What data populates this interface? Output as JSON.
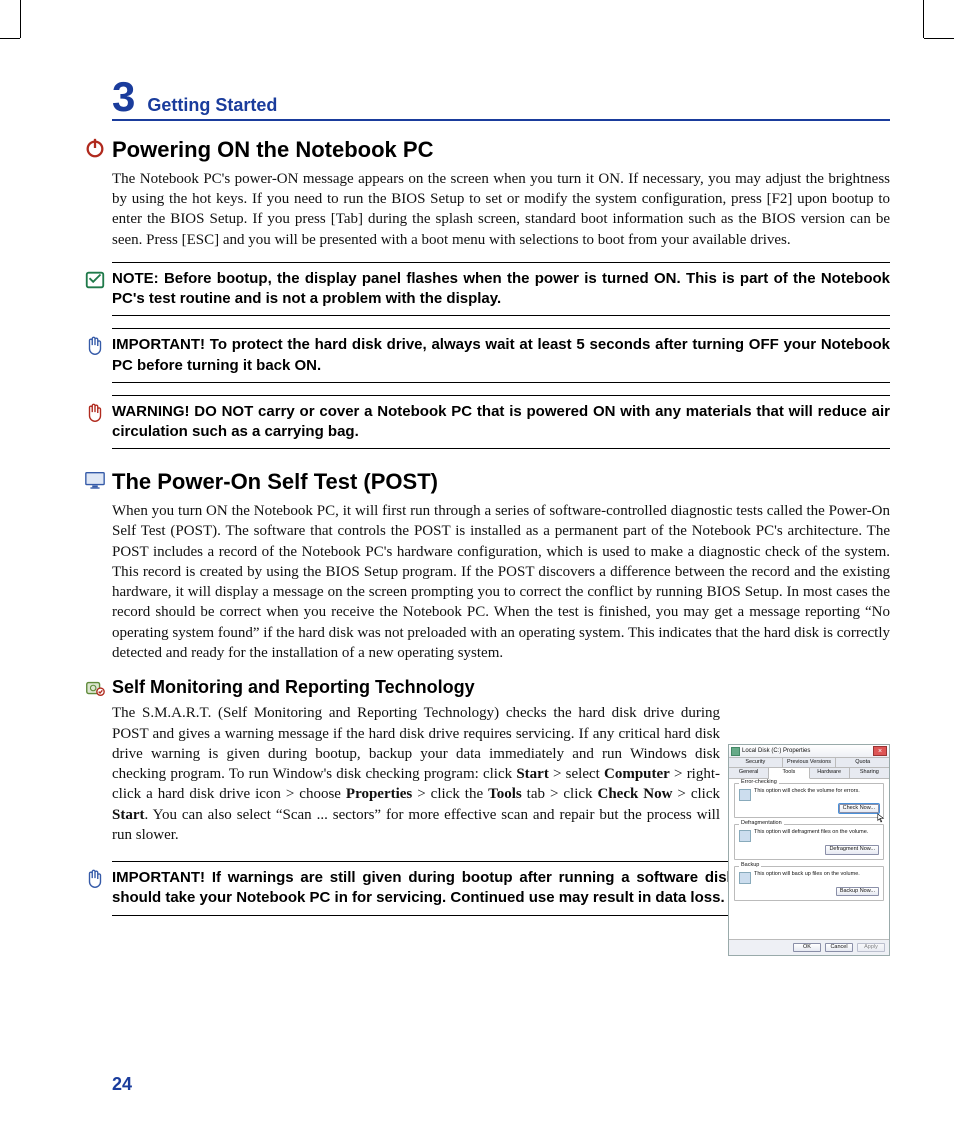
{
  "chapter": {
    "number": "3",
    "title": "Getting Started"
  },
  "page_number": "24",
  "sections": {
    "power_on": {
      "heading": "Powering ON the Notebook PC",
      "body": "The Notebook PC's power-ON message appears on the screen when you turn it ON. If necessary, you may adjust the brightness by using the hot keys. If you need to run the BIOS Setup to set or modify the system configuration, press [F2] upon bootup to enter the BIOS Setup. If you press [Tab] during the splash screen, standard boot information such as the BIOS version can be seen. Press [ESC] and you will be presented with a boot menu with selections to boot from your available drives."
    },
    "post": {
      "heading": "The Power-On Self Test (POST)",
      "body": "When you turn ON the Notebook PC, it will first run through a series of software-controlled diagnostic tests called the Power-On Self Test (POST). The software that controls the POST is installed as a permanent part of the Notebook PC's architecture. The POST includes a record of the Notebook PC's hardware configuration, which is used to make a diagnostic check of the system. This record is created by using the BIOS Setup program. If the POST discovers a difference between the record and the existing hardware, it will display a message on the screen prompting you to correct the conflict by running BIOS Setup. In most cases the record should be correct when you receive the Notebook PC. When the test is finished, you may get a message reporting “No operating system found” if the hard disk was not preloaded with an operating system. This indicates that the hard disk is correctly detected and ready for the installation of a new operating system."
    },
    "smart": {
      "heading": "Self Monitoring and Reporting Technology",
      "text_pieces": {
        "p1": "The S.M.A.R.T. (Self Monitoring and Reporting Technology) checks the hard disk drive during POST and gives a warning message if the hard disk drive requires servicing. If any critical hard disk drive warning is given during bootup, backup your data immediately and run Windows disk checking program. To run Window's disk checking program: click ",
        "b1": "Start",
        "gt1": " > ",
        "s2": "select ",
        "b2": "Computer",
        "gt2": " > ",
        "s3": "right-click a hard disk drive icon > choose ",
        "b3": "Properties",
        "gt3": " > ",
        "s4": "click the ",
        "b4": "Tools",
        "s5": " tab > click ",
        "b5": "Check Now",
        "gt4": " > ",
        "s6": "click ",
        "b6": "Start",
        "p2": ". You can also select “Scan ... sectors” for more effective scan and repair but the process will run slower."
      }
    }
  },
  "callouts": {
    "note": "NOTE:  Before bootup, the display panel flashes when the power is turned ON. This is part of the Notebook PC's test routine and is not a problem with the display.",
    "important1": "IMPORTANT!  To protect the hard disk drive, always wait at least 5 seconds after turning OFF your Notebook PC before turning it back ON.",
    "warning": "WARNING! DO NOT carry or cover a Notebook PC that is powered ON with any materials that will reduce air circulation such as a carrying bag.",
    "important2": "IMPORTANT! If warnings are still given during bootup after running a software disk checking utility, you should take your Notebook PC in for servicing. Continued use may result in data loss."
  },
  "figure": {
    "title": "Local Disk (C:) Properties",
    "tabs_row1": [
      "Security",
      "Previous Versions",
      "Quota"
    ],
    "tabs_row2": [
      "General",
      "Tools",
      "Hardware",
      "Sharing"
    ],
    "active_tab": "Tools",
    "groups": {
      "error": {
        "legend": "Error-checking",
        "desc": "This option will check the volume for errors.",
        "button": "Check Now..."
      },
      "defrag": {
        "legend": "Defragmentation",
        "desc": "This option will defragment files on the volume.",
        "button": "Defragment Now..."
      },
      "backup": {
        "legend": "Backup",
        "desc": "This option will back up files on the volume.",
        "button": "Backup Now..."
      }
    },
    "footer": {
      "ok": "OK",
      "cancel": "Cancel",
      "apply": "Apply"
    }
  }
}
